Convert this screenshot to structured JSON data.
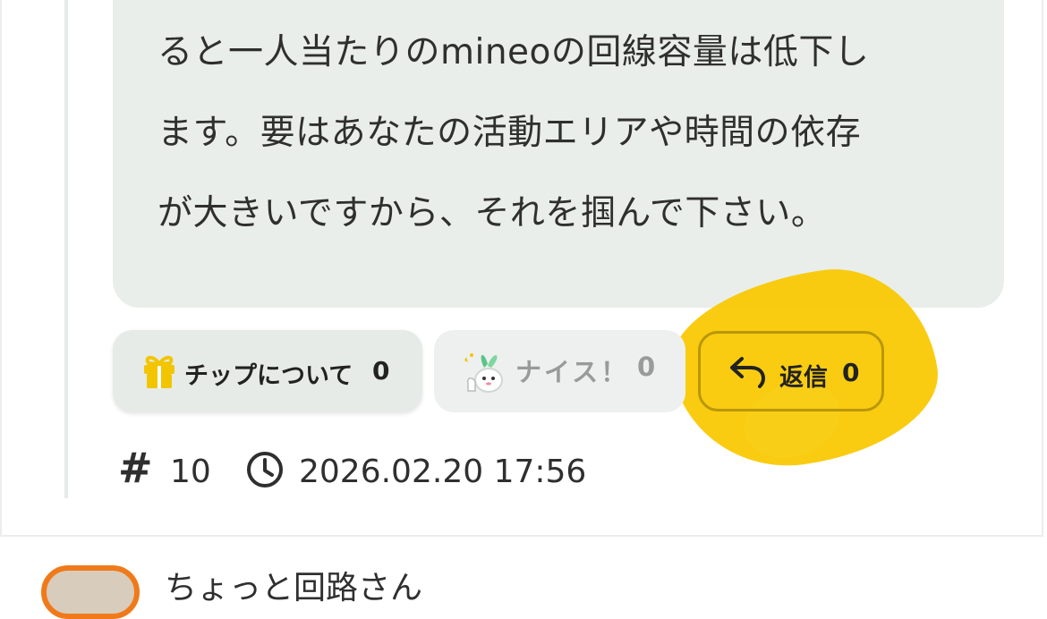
{
  "post": {
    "body_lines": [
      "ると一人当たりのmineoの回線容量は低下し",
      "ます。要はあなたの活動エリアや時間の依存",
      "が大きいですから、それを掴んで下さい。"
    ],
    "body_text": "ると一人当たりのmineoの回線容量は低下し\nます。要はあなたの活動エリアや時間の依存\nが大きいですから、それを掴んで下さい。",
    "actions": {
      "tip": {
        "label": "チップについて",
        "count": "0",
        "icon": "gift-icon"
      },
      "nice": {
        "label": "ナイス！",
        "count": "0",
        "icon": "mascot-icon"
      },
      "reply": {
        "label": "返信",
        "count": "0",
        "icon": "reply-arrow-icon"
      }
    },
    "meta": {
      "hash_symbol": "#",
      "post_number": "10",
      "clock_icon": "clock-icon",
      "timestamp": "2026.02.20 17:56"
    }
  },
  "next_post": {
    "author_partial": "ちょっと回路さん"
  },
  "colors": {
    "bubble_bg": "#e9eeea",
    "highlight": "#f9c800",
    "gift_icon": "#f2c500",
    "avatar_ring": "#f07a1a"
  }
}
